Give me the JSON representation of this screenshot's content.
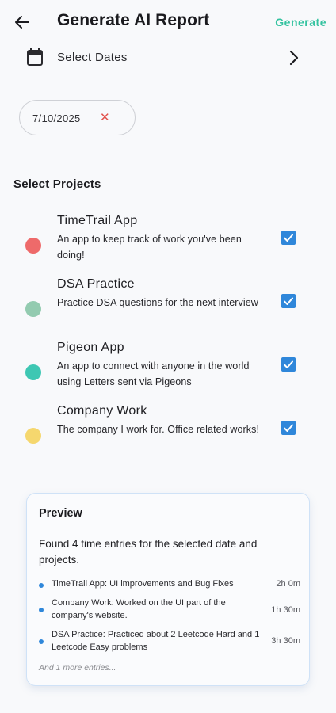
{
  "header": {
    "title": "Generate AI Report",
    "generate_label": "Generate"
  },
  "date_selector": {
    "label": "Select Dates",
    "chips": [
      "7/10/2025"
    ]
  },
  "projects_section": {
    "title": "Select Projects",
    "items": [
      {
        "name": "TimeTrail App",
        "description": "An app to keep track of work you've been doing!",
        "color": "#ee6a6a",
        "checked": true
      },
      {
        "name": "DSA Practice",
        "description": "Practice DSA questions for the next interview",
        "color": "#93cbb0",
        "checked": true
      },
      {
        "name": "Pigeon App",
        "description": "An app to connect with anyone in the world using Letters sent via Pigeons",
        "color": "#3ec7b3",
        "checked": true
      },
      {
        "name": "Company Work",
        "description": "The company I work for. Office related works!",
        "color": "#f5d76e",
        "checked": true
      }
    ]
  },
  "preview": {
    "title": "Preview",
    "summary": "Found 4 time entries for the selected date and projects.",
    "entries": [
      {
        "text": "TimeTrail App: UI improvements and Bug Fixes",
        "duration": "2h 0m"
      },
      {
        "text": "Company Work: Worked on the UI part of the company's website.",
        "duration": "1h 30m"
      },
      {
        "text": "DSA Practice: Practiced about 2 Leetcode Hard and 1 Leetcode Easy problems",
        "duration": "3h 30m"
      }
    ],
    "more_label": "And 1 more entries..."
  },
  "colors": {
    "accent": "#34c3a0",
    "checkbox": "#2f87da",
    "remove": "#e2524c"
  },
  "icons": {
    "back": "arrow-left-icon",
    "calendar": "calendar-icon",
    "chevron": "chevron-right-icon",
    "remove": "close-icon",
    "checkbox": "check-icon"
  }
}
